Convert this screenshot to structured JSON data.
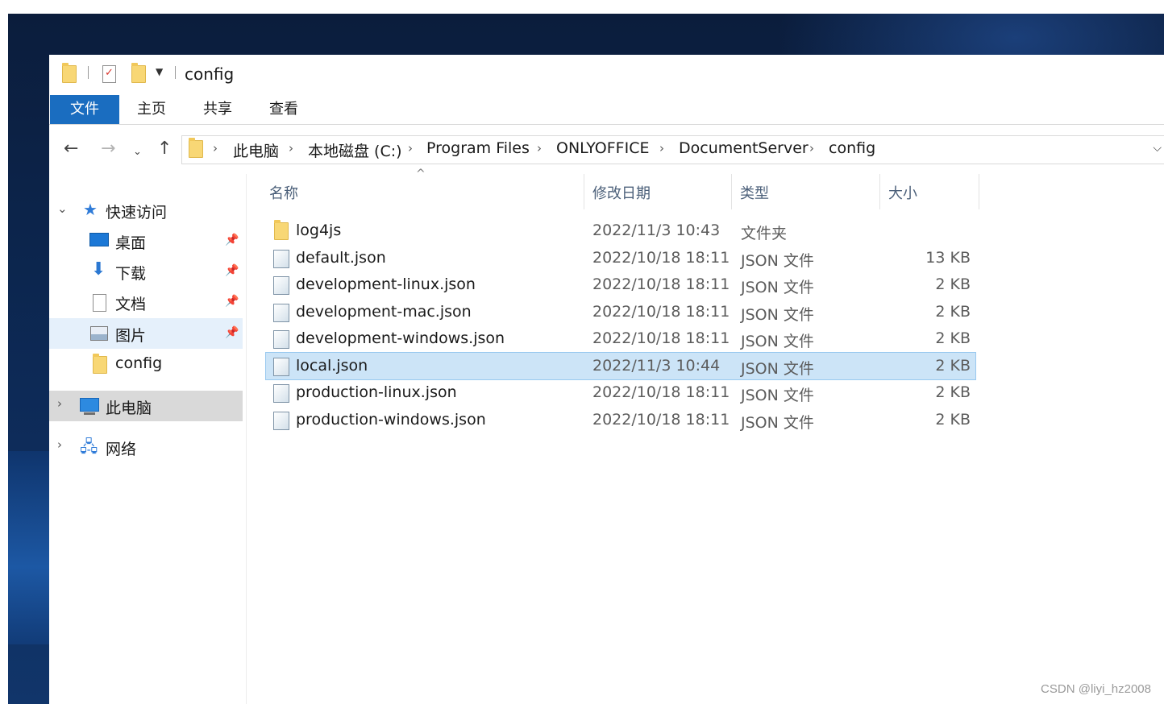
{
  "window": {
    "title": "config"
  },
  "ribbon": {
    "tabs": [
      "文件",
      "主页",
      "共享",
      "查看"
    ]
  },
  "address": {
    "breadcrumbs": [
      "此电脑",
      "本地磁盘 (C:)",
      "Program Files",
      "ONLYOFFICE",
      "DocumentServer",
      "config"
    ]
  },
  "navigation": {
    "quick_access": "快速访问",
    "pinned": [
      {
        "label": "桌面",
        "icon": "desktop-icon"
      },
      {
        "label": "下载",
        "icon": "download-icon"
      },
      {
        "label": "文档",
        "icon": "documents-icon"
      },
      {
        "label": "图片",
        "icon": "pictures-icon"
      }
    ],
    "recent_folder": "config",
    "this_pc": "此电脑",
    "network": "网络"
  },
  "columns": {
    "name": "名称",
    "date": "修改日期",
    "type": "类型",
    "size": "大小"
  },
  "files": [
    {
      "name": "log4js",
      "date": "2022/11/3 10:43",
      "type": "文件夹",
      "size": "",
      "kind": "folder"
    },
    {
      "name": "default.json",
      "date": "2022/10/18 18:11",
      "type": "JSON 文件",
      "size": "13 KB",
      "kind": "json"
    },
    {
      "name": "development-linux.json",
      "date": "2022/10/18 18:11",
      "type": "JSON 文件",
      "size": "2 KB",
      "kind": "json"
    },
    {
      "name": "development-mac.json",
      "date": "2022/10/18 18:11",
      "type": "JSON 文件",
      "size": "2 KB",
      "kind": "json"
    },
    {
      "name": "development-windows.json",
      "date": "2022/10/18 18:11",
      "type": "JSON 文件",
      "size": "2 KB",
      "kind": "json"
    },
    {
      "name": "local.json",
      "date": "2022/11/3 10:44",
      "type": "JSON 文件",
      "size": "2 KB",
      "kind": "json",
      "selected": true
    },
    {
      "name": "production-linux.json",
      "date": "2022/10/18 18:11",
      "type": "JSON 文件",
      "size": "2 KB",
      "kind": "json"
    },
    {
      "name": "production-windows.json",
      "date": "2022/10/18 18:11",
      "type": "JSON 文件",
      "size": "2 KB",
      "kind": "json"
    }
  ],
  "watermark": "CSDN @liyi_hz2008",
  "colors": {
    "accent": "#1a6dc0",
    "selection": "#cce4f7",
    "folder": "#f8d775"
  }
}
